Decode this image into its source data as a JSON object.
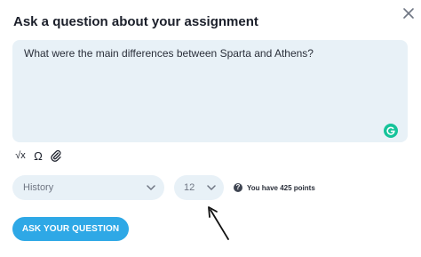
{
  "dialog": {
    "title": "Ask a question about your assignment",
    "close_icon": "close-icon"
  },
  "question": {
    "value": "What were the main differences between Sparta and Athens?",
    "grammarly_icon": "grammarly-icon"
  },
  "toolbar": {
    "items": [
      {
        "icon": "square-root-icon",
        "glyph": "√x"
      },
      {
        "icon": "omega-icon",
        "glyph": "Ω"
      },
      {
        "icon": "paperclip-icon"
      }
    ]
  },
  "subject_select": {
    "value": "History",
    "icon": "chevron-down-icon"
  },
  "number_select": {
    "value": "12",
    "icon": "chevron-down-icon"
  },
  "points": {
    "text": "You have 425 points",
    "icon": "help-icon",
    "help_glyph": "?"
  },
  "ask_button": {
    "label": "ASK YOUR QUESTION"
  },
  "annotation": {
    "icon": "arrow-pointer-icon"
  },
  "colors": {
    "field_bg": "#e8f1f7",
    "accent": "#2ea8e6",
    "grammarly": "#15c39a"
  }
}
